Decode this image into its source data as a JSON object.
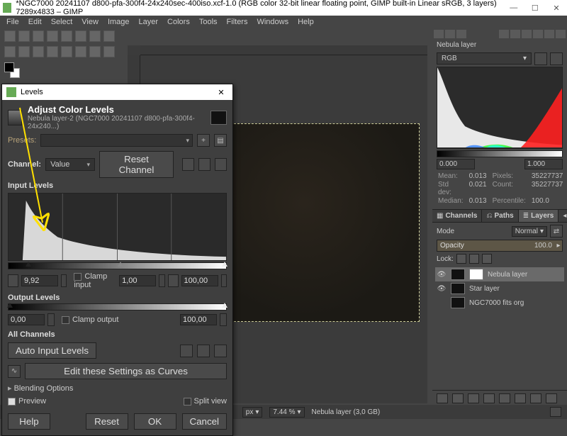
{
  "window": {
    "title": "*NGC7000 20241107 d800-pfa-300f4-24x240sec-400iso.xcf-1.0 (RGB color 32-bit linear floating point, GIMP built-in Linear sRGB, 3 layers) 7289x4833 – GIMP"
  },
  "menubar": [
    "File",
    "Edit",
    "Select",
    "View",
    "Image",
    "Layer",
    "Colors",
    "Tools",
    "Filters",
    "Windows",
    "Help"
  ],
  "rightpanel": {
    "title": "Nebula layer",
    "channel": "RGB",
    "range_min": "0.000",
    "range_max": "1.000",
    "stats": {
      "mean_l": "Mean:",
      "mean_v": "0.013",
      "pixels_l": "Pixels:",
      "pixels_v": "35227737",
      "std_l": "Std dev:",
      "std_v": "0.021",
      "count_l": "Count:",
      "count_v": "35227737",
      "median_l": "Median:",
      "median_v": "0.013",
      "pct_l": "Percentile:",
      "pct_v": "100.0"
    },
    "tabs2": {
      "channels": "Channels",
      "paths": "Paths",
      "layers": "Layers"
    },
    "mode_l": "Mode",
    "mode_v": "Normal",
    "opacity_l": "Opacity",
    "opacity_v": "100.0",
    "lock_l": "Lock:",
    "layers": [
      {
        "name": "Nebula layer",
        "eye": "👁",
        "mask": true
      },
      {
        "name": "Star layer",
        "eye": "👁",
        "mask": false
      },
      {
        "name": "NGC7000 fits org",
        "eye": "",
        "mask": false
      }
    ]
  },
  "status": {
    "unit": "px",
    "zoom": "7.44 %",
    "info": "Nebula layer (3,0 GB)"
  },
  "dialog": {
    "title": "Levels",
    "heading": "Adjust Color Levels",
    "sub": "Nebula layer-2 (NGC7000 20241107 d800-pfa-300f4-24x240...)",
    "presets_l": "Presets:",
    "channel_l": "Channel:",
    "channel_v": "Value",
    "reset_channel": "Reset Channel",
    "input_l": "Input Levels",
    "clamp_input_l": "Clamp input",
    "low": "9,92",
    "gamma": "1,00",
    "high": "100,00",
    "output_l": "Output Levels",
    "clamp_output_l": "Clamp output",
    "out_low": "0,00",
    "out_high": "100,00",
    "all_ch": "All Channels",
    "auto": "Auto Input Levels",
    "curves": "Edit these Settings as Curves",
    "blending": "Blending Options",
    "preview": "Preview",
    "split": "Split view",
    "help": "Help",
    "reset": "Reset",
    "ok": "OK",
    "cancel": "Cancel"
  }
}
